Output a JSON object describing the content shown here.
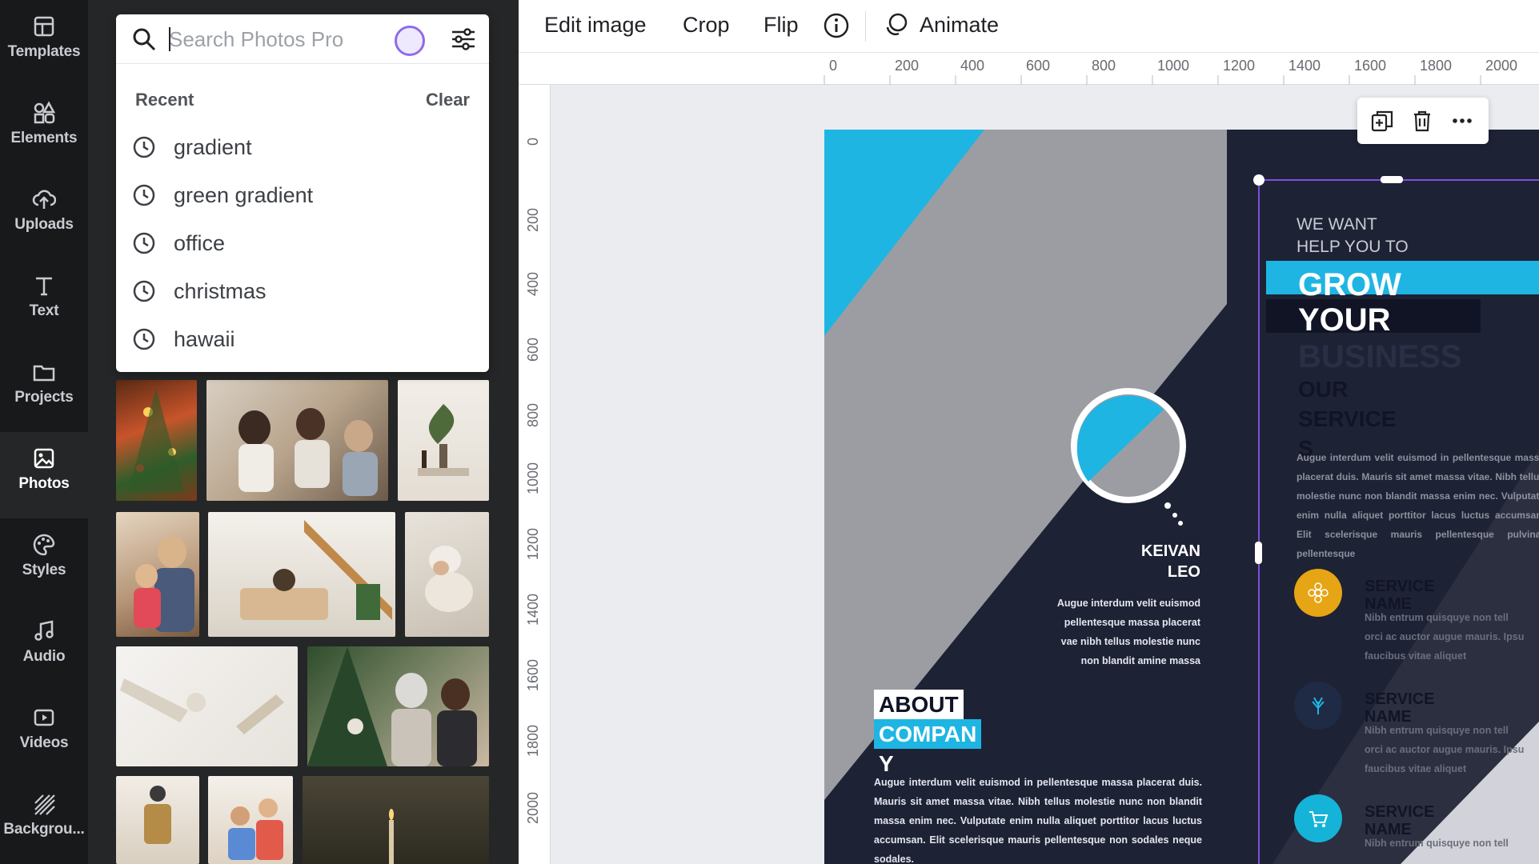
{
  "rail": {
    "items": [
      {
        "label": "Templates",
        "icon": "templates-icon"
      },
      {
        "label": "Elements",
        "icon": "elements-icon"
      },
      {
        "label": "Uploads",
        "icon": "uploads-icon"
      },
      {
        "label": "Text",
        "icon": "text-icon"
      },
      {
        "label": "Projects",
        "icon": "folder-icon"
      },
      {
        "label": "Photos",
        "icon": "photos-icon",
        "active": true
      },
      {
        "label": "Styles",
        "icon": "palette-icon"
      },
      {
        "label": "Audio",
        "icon": "music-icon"
      },
      {
        "label": "Videos",
        "icon": "video-icon"
      },
      {
        "label": "Backgrou...",
        "icon": "background-icon"
      }
    ]
  },
  "search": {
    "placeholder": "Search Photos Pro",
    "value": "",
    "recent_label": "Recent",
    "clear_label": "Clear",
    "recent": [
      "gradient",
      "green gradient",
      "office",
      "christmas",
      "hawaii"
    ]
  },
  "toolbar": {
    "edit_image": "Edit image",
    "crop": "Crop",
    "flip": "Flip",
    "animate": "Animate"
  },
  "ruler": {
    "top": [
      "0",
      "200",
      "400",
      "600",
      "800",
      "1000",
      "1200",
      "1400",
      "1600",
      "1800",
      "2000"
    ],
    "left": [
      "0",
      "200",
      "400",
      "600",
      "800",
      "1000",
      "1200",
      "1400",
      "1600",
      "1800",
      "2000"
    ]
  },
  "design": {
    "want_help": "WE WANT HELP YOU TO",
    "grow": "GROW",
    "your": "YOUR",
    "business": "BUSINESS",
    "our_services": [
      "OUR",
      "SERVICE",
      "S"
    ],
    "services_body": "Augue interdum velit euismod in pellentesque massa placerat duis. Mauris sit amet massa vitae. Nibh tellus molestie nunc non blandit massa enim nec. Vulputate enim nulla aliquet porttitor lacus luctus accumsan. Elit scelerisque mauris pellentesque pulvinar pellentesque",
    "person_name": [
      "KEIVAN",
      "LEO"
    ],
    "person_body": [
      "Augue interdum velit euismod",
      "pellentesque massa placerat",
      "vae nibh tellus molestie nunc",
      "non blandit amine massa"
    ],
    "about": [
      "ABOUT",
      "COMPAN",
      "Y"
    ],
    "about_body": "Augue interdum velit euismod in pellentesque massa placerat duis. Mauris sit amet massa vitae. Nibh tellus molestie nunc non blandit massa enim nec. Vulputate enim nulla aliquet porttitor lacus luctus accumsan. Elit scelerisque mauris pellentesque non sodales neque sodales.",
    "service_items": [
      {
        "title": [
          "SERVICE",
          "NAME"
        ],
        "body": [
          "Nibh entrum quisquye non tell",
          "orci ac auctor augue mauris. Ipsu",
          "faucibus vitae aliquet"
        ],
        "color": "#e6a514"
      },
      {
        "title": [
          "SERVICE",
          "NAME"
        ],
        "body": [
          "Nibh entrum quisquye non tell",
          "orci ac auctor augue mauris. Ipsu",
          "faucibus vitae aliquet"
        ],
        "color": "#1f2a44"
      },
      {
        "title": [
          "SERVICE",
          "NAME"
        ],
        "body": [
          "Nibh entrum quisquye non tell"
        ],
        "color": "#16b3d8"
      }
    ]
  },
  "colors": {
    "accent_blue": "#1fb5e3",
    "navy": "#1e2235",
    "grey": "#9b9da3",
    "selection": "#7d4fe0"
  }
}
